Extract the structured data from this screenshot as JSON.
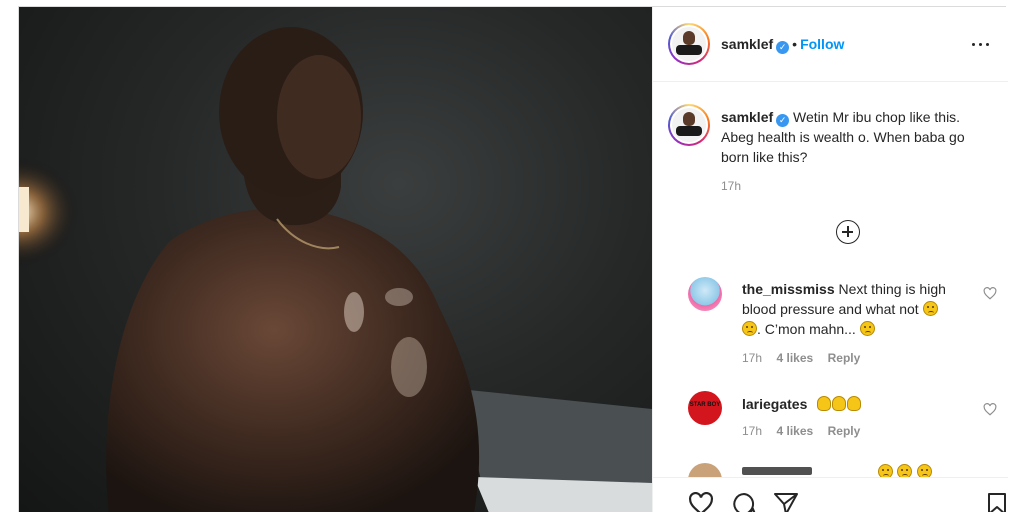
{
  "post": {
    "author": "samklef",
    "dot": "•",
    "follow_label": "Follow",
    "caption": "Wetin Mr ibu chop like this. Abeg health is wealth o. When baba go born like this?",
    "caption_time": "17h",
    "icons": {
      "verified": "verified-badge-icon",
      "more": "more-options-icon",
      "load_more": "plus-circle-icon",
      "like": "heart-icon",
      "comment": "comment-icon",
      "share": "paper-plane-icon",
      "save": "bookmark-icon"
    }
  },
  "comments": [
    {
      "username": "the_missmiss",
      "text_1": "Next thing is high",
      "text_2": "blood pressure and what not",
      "text_3": ". C’mon mahn...",
      "time": "17h",
      "likes": "4 likes",
      "reply": "Reply"
    },
    {
      "username": "lariegates",
      "avatar_text": "STAR BOY",
      "time": "17h",
      "likes": "4 likes",
      "reply": "Reply"
    }
  ],
  "colors": {
    "accent": "#0095f6",
    "verified": "#3897f0",
    "muted": "#8e8e8e",
    "text": "#262626"
  }
}
